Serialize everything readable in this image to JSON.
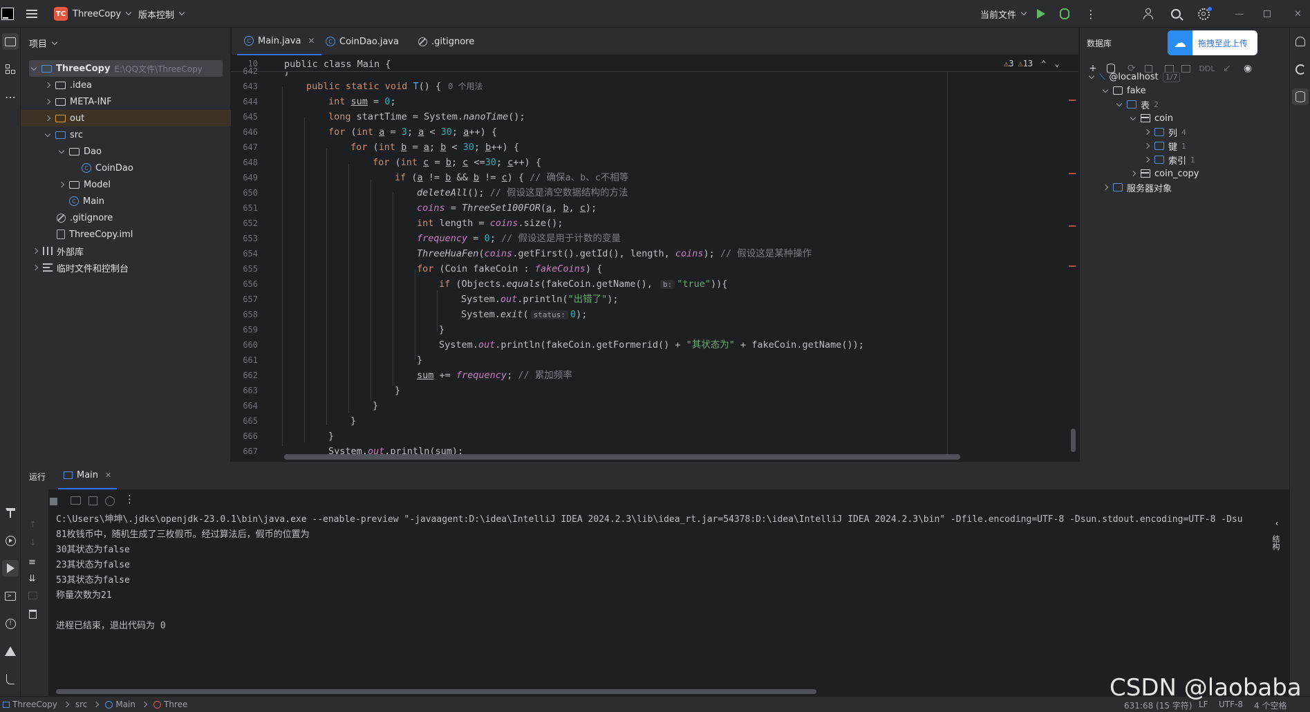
{
  "titlebar": {
    "project_badge": "TC",
    "project_name": "ThreeCopy",
    "vcs_label": "版本控制",
    "run_config": "当前文件"
  },
  "project_panel": {
    "title": "项目",
    "root": {
      "name": "ThreeCopy",
      "path": "E:\\QQ文件\\ThreeCopy"
    },
    "items": [
      {
        "label": ".idea"
      },
      {
        "label": "META-INF"
      },
      {
        "label": "out"
      },
      {
        "label": "src"
      },
      {
        "label": "Dao"
      },
      {
        "label": "CoinDao"
      },
      {
        "label": "Model"
      },
      {
        "label": "Main"
      },
      {
        "label": ".gitignore"
      },
      {
        "label": "ThreeCopy.iml"
      },
      {
        "label": "外部库"
      },
      {
        "label": "临时文件和控制台"
      }
    ]
  },
  "editor": {
    "tabs": [
      {
        "label": "Main.java"
      },
      {
        "label": "CoinDao.java"
      },
      {
        "label": ".gitignore"
      }
    ],
    "sticky_line_no": "10",
    "sticky_code": "public class Main {",
    "warnings": "3",
    "weak_warnings": "13",
    "line_numbers": [
      "642",
      "643",
      "644",
      "645",
      "646",
      "647",
      "648",
      "649",
      "650",
      "651",
      "652",
      "653",
      "654",
      "655",
      "656",
      "657",
      "658",
      "659",
      "660",
      "661",
      "662",
      "663",
      "664",
      "665",
      "666",
      "667"
    ],
    "usage_hint": "0 个用法",
    "comments": {
      "c649": "// 确保a、b、c不相等",
      "c650": "// 假设这是清空数据结构的方法",
      "c653": "// 假设这是用于计数的变量",
      "c654": "// 假设这是某种操作",
      "c662": "// 累加频率"
    },
    "strings": {
      "s656": "\"true\"",
      "s657": "\"出错了\"",
      "s660": "\"其状态为\""
    },
    "param_hints": {
      "b": "b:",
      "status": "status:"
    }
  },
  "db_panel": {
    "title": "数据库",
    "upload_button": "拖拽至此上传",
    "tool_ddl": "DDL",
    "tree": [
      {
        "label": "@localhost",
        "count": "1/7"
      },
      {
        "label": "fake"
      },
      {
        "label": "表",
        "count": "2"
      },
      {
        "label": "coin"
      },
      {
        "label": "列",
        "count": "4"
      },
      {
        "label": "键",
        "count": "1"
      },
      {
        "label": "索引",
        "count": "1"
      },
      {
        "label": "coin_copy"
      },
      {
        "label": "服务器对象"
      }
    ]
  },
  "run_panel": {
    "title": "运行",
    "tab": "Main",
    "side_label": "结构",
    "output": [
      "C:\\Users\\坤坤\\.jdks\\openjdk-23.0.1\\bin\\java.exe --enable-preview \"-javaagent:D:\\idea\\IntelliJ IDEA 2024.2.3\\lib\\idea_rt.jar=54378:D:\\idea\\IntelliJ IDEA 2024.2.3\\bin\" -Dfile.encoding=UTF-8 -Dsun.stdout.encoding=UTF-8 -Dsu",
      "81枚钱币中，随机生成了三枚假币。经过算法后，假币的位置为",
      "30其状态为false",
      "23其状态为false",
      "53其状态为false",
      "称量次数为21",
      "",
      "进程已结束，退出代码为 0"
    ]
  },
  "statusbar": {
    "crumbs": [
      "ThreeCopy",
      "src",
      "Main",
      "Three"
    ],
    "position": "631:68 (15 字符)",
    "line_sep": "LF",
    "encoding": "UTF-8",
    "indent": "4 个空格"
  },
  "watermark": "CSDN @laobaba"
}
